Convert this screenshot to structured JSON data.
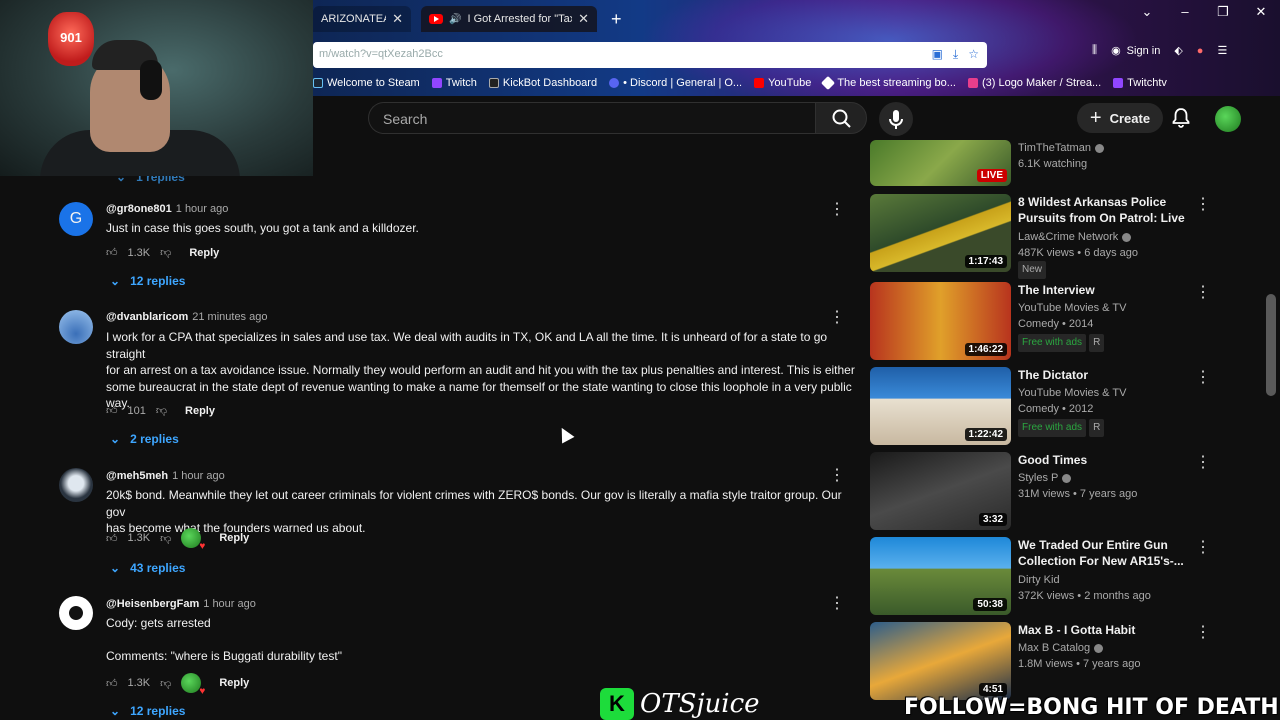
{
  "browser": {
    "tabs": [
      {
        "label": "ARIZONATEARS Pl"
      },
      {
        "label": "I Got Arrested for \"Tax Evas"
      }
    ],
    "url": "m/watch?v=qtXezah2Bcc",
    "signin": "Sign in",
    "bookmarks": [
      {
        "label": "Welcome to Steam",
        "color": "#1b2838"
      },
      {
        "label": "Twitch",
        "color": "#9146ff"
      },
      {
        "label": "KickBot Dashboard",
        "color": "#222222"
      },
      {
        "label": "• Discord | General | O...",
        "color": "#5865f2"
      },
      {
        "label": "YouTube",
        "color": "#ff0000"
      },
      {
        "label": "The best streaming bo...",
        "color": "#ffffff"
      },
      {
        "label": "(3) Logo Maker / Strea...",
        "color": "#e83e8c"
      },
      {
        "label": "Twitchtv",
        "color": "#9146ff"
      }
    ]
  },
  "webcam": {
    "badge_text": "901"
  },
  "header": {
    "search_placeholder": "Search",
    "create_label": "Create"
  },
  "comments": [
    {
      "author": "@gr8one801",
      "time": "1 hour ago",
      "text": "Just in case this goes south, you got a tank and a killdozer.",
      "likes": "1.3K",
      "reply": "Reply",
      "replies": "12 replies",
      "avatar_letter": "G",
      "avatar_color": "#1a73e8"
    },
    {
      "author": "@dvanblaricom",
      "time": "21 minutes ago",
      "text": "I work for a CPA that specializes in sales and use tax.  We deal with audits in TX, OK and LA all the time.  It is unheard of for a state to go straight\nfor an arrest on a tax avoidance issue.  Normally they would perform an audit and hit you with the tax plus penalties and interest.  This is either\nsome bureaucrat in the state dept of revenue wanting to make a name for themself or the state wanting to close this loophole in a very public\nway.",
      "likes": "101",
      "reply": "Reply",
      "replies": "2 replies"
    },
    {
      "author": "@meh5meh",
      "time": "1 hour ago",
      "text": "20k$ bond.  Meanwhile they let out career criminals for violent crimes with ZERO$ bonds.  Our gov is literally a mafia style traitor group.  Our gov\nhas become what the founders warned us about.",
      "likes": "1.3K",
      "reply": "Reply",
      "replies": "43 replies"
    },
    {
      "author": "@HeisenbergFam",
      "time": "1 hour ago",
      "text": "Cody: gets arrested\n\nComments: \"where is Buggati durability test\"",
      "likes": "1.3K",
      "reply": "Reply",
      "replies": "12 replies"
    }
  ],
  "partial_replies": "1 replies",
  "sidebar": [
    {
      "title": "",
      "channel": "TimTheTatman",
      "meta": "6.1K watching",
      "badge": "LIVE",
      "thumb_color": "#3a5a2a"
    },
    {
      "title": "8 Wildest Arkansas Police Pursuits from On Patrol: Live",
      "channel": "Law&Crime Network",
      "meta": "487K views • 6 days ago",
      "tag": "New",
      "duration": "1:17:43",
      "thumb_color": "#2e4a2a"
    },
    {
      "title": "The Interview",
      "channel": "YouTube Movies & TV",
      "meta": "Comedy • 2014",
      "tag": "Free with ads",
      "rating": "R",
      "duration": "1:46:22",
      "thumb_color": "#b8341e"
    },
    {
      "title": "The Dictator",
      "channel": "YouTube Movies & TV",
      "meta": "Comedy • 2012",
      "tag": "Free with ads",
      "rating": "R",
      "duration": "1:22:42",
      "thumb_color": "#1f5fa8"
    },
    {
      "title": "Good Times",
      "channel": "Styles P",
      "meta": "31M views • 7 years ago",
      "duration": "3:32",
      "thumb_color": "#2a2a2a"
    },
    {
      "title": "We Traded Our Entire Gun Collection For New AR15's-...",
      "channel": "Dirty Kid",
      "meta": "372K views • 2 months ago",
      "duration": "50:38",
      "thumb_color": "#1e88d8"
    },
    {
      "title": "Max B - I Gotta Habit",
      "channel": "Max B Catalog",
      "meta": "1.8M views • 7 years ago",
      "duration": "4:51",
      "thumb_color": "#2d5d8a"
    }
  ],
  "overlay": {
    "brand_letter": "K",
    "brand_name": "OTSjuice",
    "ticker": "FOLLOW=BONG HIT OF DEATH!!!"
  }
}
